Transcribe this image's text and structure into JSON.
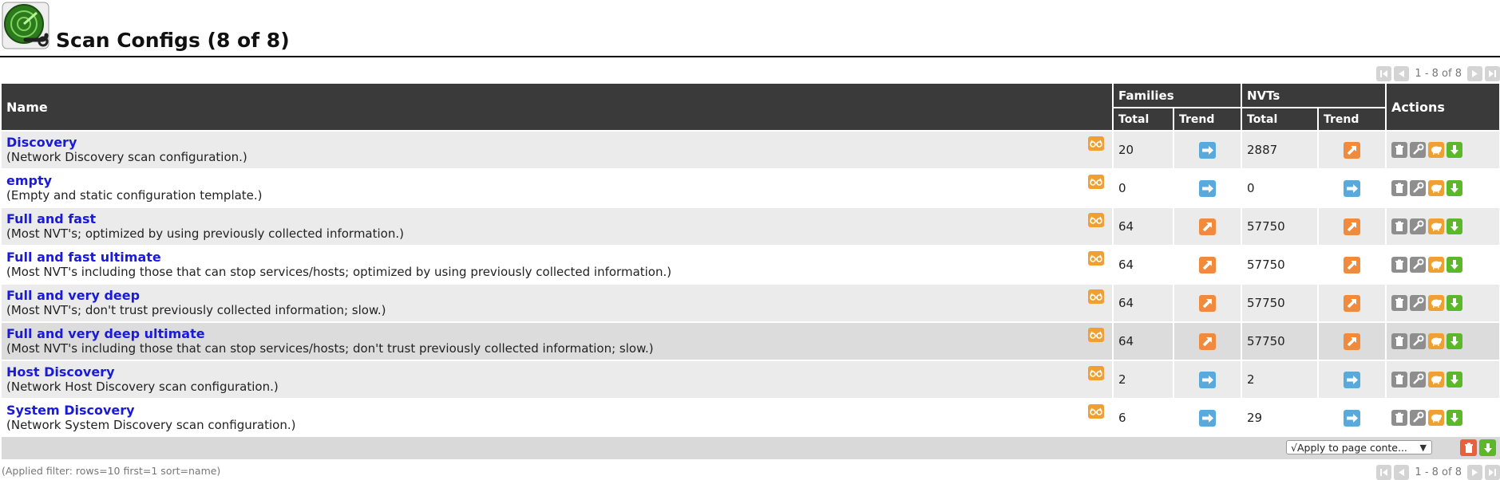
{
  "page": {
    "title": "Scan Configs (8 of 8)",
    "logo_icon": "scan-config-radar-wrench-icon"
  },
  "pagination_top": {
    "count": "1 - 8 of 8",
    "icons": [
      "first-page-icon",
      "previous-page-icon",
      "next-page-icon",
      "last-page-icon"
    ]
  },
  "pagination_bottom": {
    "count": "1 - 8 of 8"
  },
  "table": {
    "headers": {
      "name": "Name",
      "families": "Families",
      "nvts": "NVTs",
      "actions": "Actions",
      "total": "Total",
      "trend": "Trend"
    },
    "rows": [
      {
        "name": "Discovery",
        "comment": "(Network Discovery scan configuration.)",
        "families_total": "20",
        "families_trend": "same",
        "nvts_total": "2887",
        "nvts_trend": "up"
      },
      {
        "name": "empty",
        "comment": "(Empty and static configuration template.)",
        "families_total": "0",
        "families_trend": "same",
        "nvts_total": "0",
        "nvts_trend": "same"
      },
      {
        "name": "Full and fast",
        "comment": "(Most NVT's; optimized by using previously collected information.)",
        "families_total": "64",
        "families_trend": "up",
        "nvts_total": "57750",
        "nvts_trend": "up"
      },
      {
        "name": "Full and fast ultimate",
        "comment": "(Most NVT's including those that can stop services/hosts; optimized by using previously collected information.)",
        "families_total": "64",
        "families_trend": "up",
        "nvts_total": "57750",
        "nvts_trend": "up"
      },
      {
        "name": "Full and very deep",
        "comment": "(Most NVT's; don't trust previously collected information; slow.)",
        "families_total": "64",
        "families_trend": "up",
        "nvts_total": "57750",
        "nvts_trend": "up"
      },
      {
        "name": "Full and very deep ultimate",
        "comment": "(Most NVT's including those that can stop services/hosts; don't trust previously collected information; slow.)",
        "families_total": "64",
        "families_trend": "up",
        "nvts_total": "57750",
        "nvts_trend": "up"
      },
      {
        "name": "Host Discovery",
        "comment": "(Network Host Discovery scan configuration.)",
        "families_total": "2",
        "families_trend": "same",
        "nvts_total": "2",
        "nvts_trend": "same"
      },
      {
        "name": "System Discovery",
        "comment": "(Network System Discovery scan configuration.)",
        "families_total": "6",
        "families_trend": "same",
        "nvts_total": "29",
        "nvts_trend": "same"
      }
    ],
    "row_icons": {
      "details": "glasses-icon",
      "actions": [
        "trash-icon",
        "edit-wrench-icon",
        "clone-sheep-icon",
        "export-download-icon"
      ]
    }
  },
  "footer": {
    "apply_select": "√Apply to page conte...",
    "bulk_icons": [
      "trash-icon",
      "export-download-icon"
    ],
    "filter_note": "(Applied filter: rows=10 first=1 sort=name)"
  },
  "colors": {
    "header_bg": "#3a3a3a",
    "link": "#1a1adb",
    "trend_same": "#58a9dc",
    "trend_up": "#f08a3c",
    "action_grey": "#8e8e8e",
    "action_orange": "#f0a030",
    "action_green": "#5cb82a"
  }
}
